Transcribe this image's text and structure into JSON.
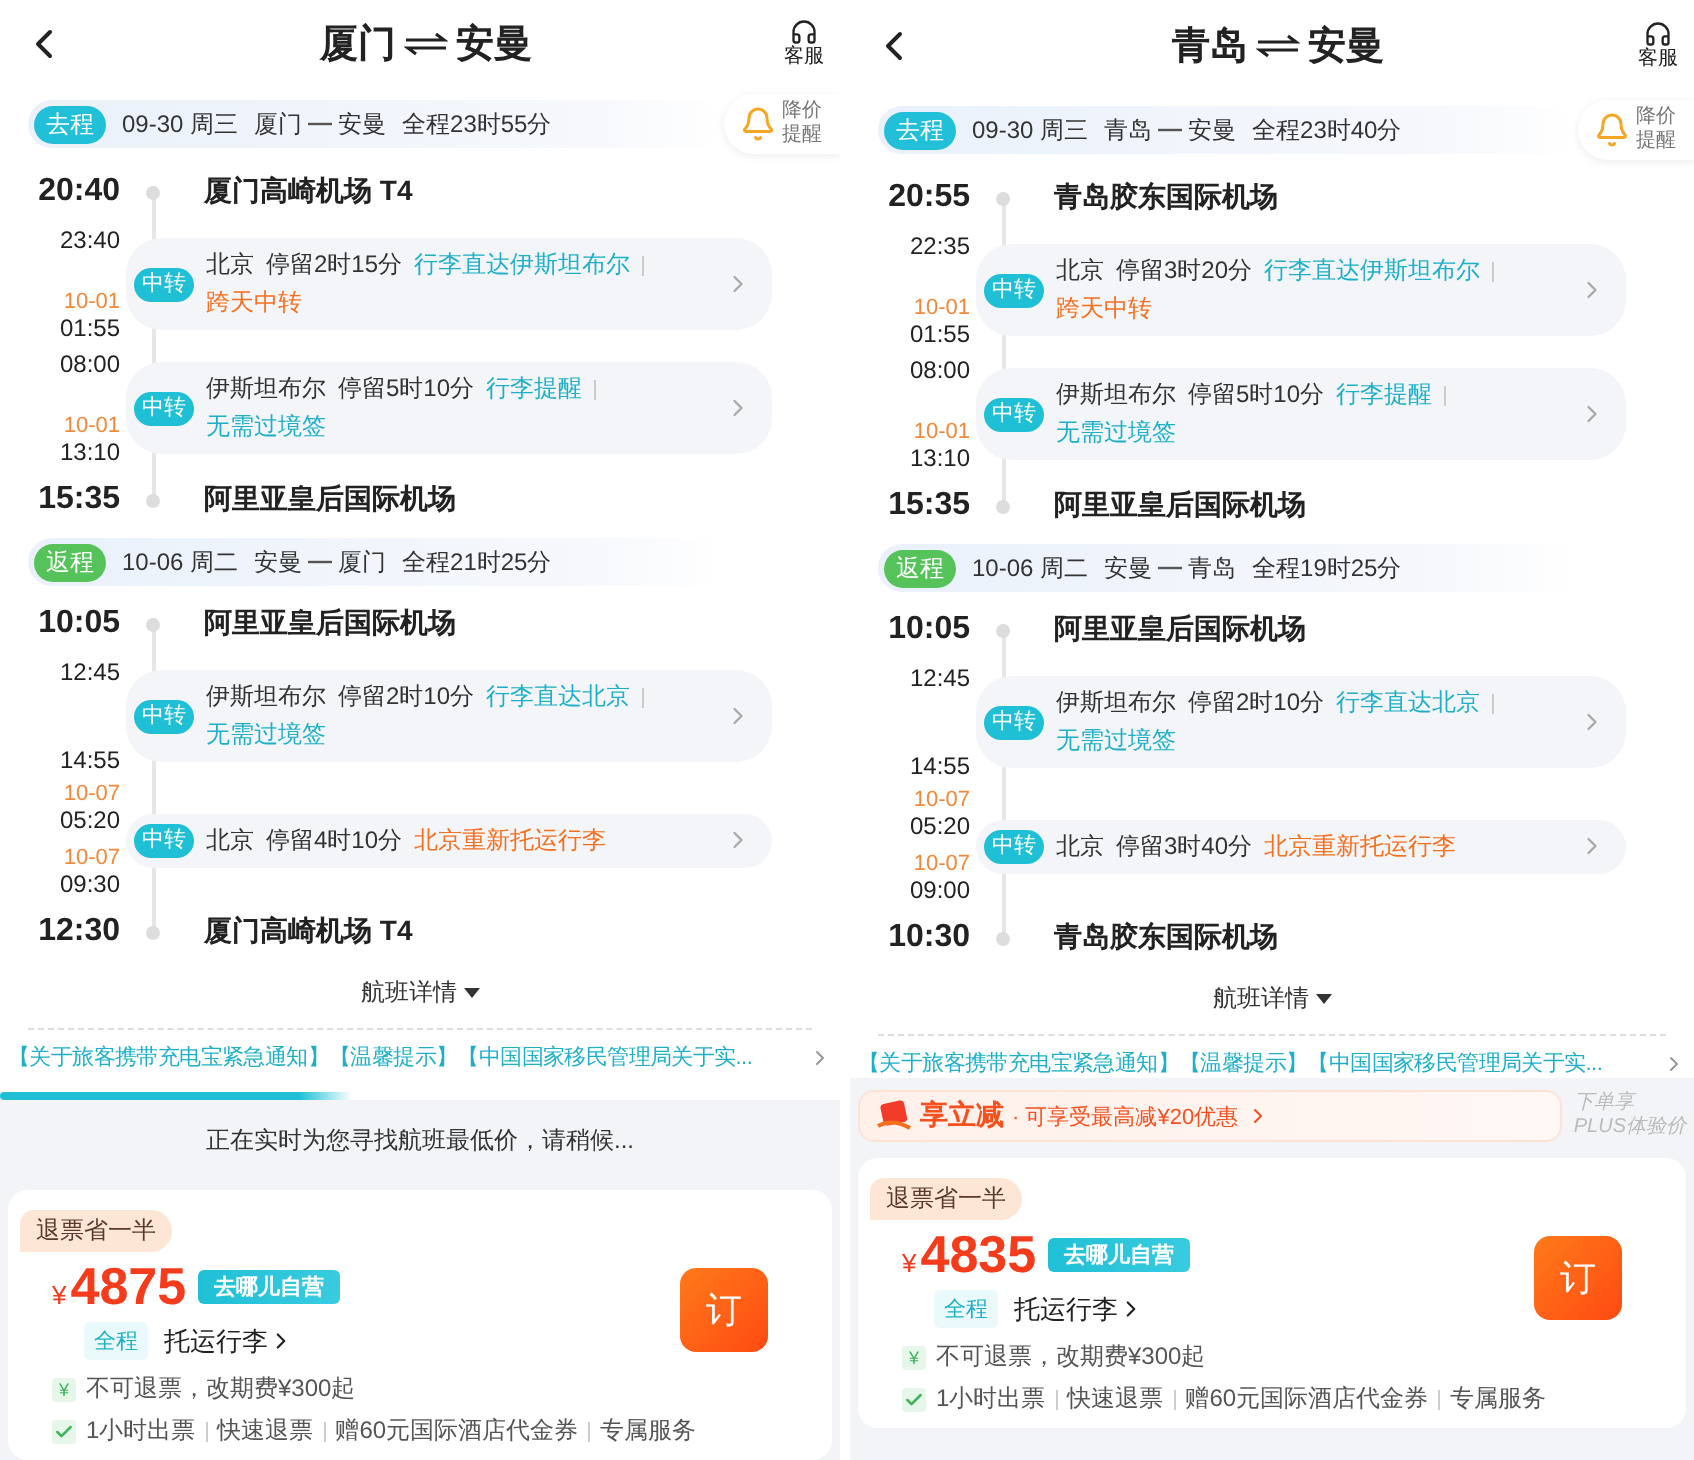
{
  "panels": [
    {
      "title": {
        "from": "厦门",
        "to": "安曼"
      },
      "support": "客服",
      "price_alert": [
        "降价",
        "提醒"
      ],
      "legs": [
        {
          "kind": "outbound",
          "tag": "去程",
          "date": "09-30 周三",
          "from": "厦门",
          "to": "安曼",
          "duration": "全程23时55分",
          "stops": [
            {
              "kind": "airport",
              "time": "20:40",
              "name": "厦门高崎机场 T4"
            },
            {
              "kind": "transfer",
              "arrive": {
                "time": "23:40"
              },
              "depart": {
                "date": "10-01",
                "time": "01:55"
              },
              "badge": "中转",
              "city": "北京",
              "stay": "停留2时15分",
              "notes": [
                {
                  "text": "行李直达伊斯坦布尔",
                  "color": "#1fb0c8"
                },
                {
                  "text": "跨天中转",
                  "color": "#f5701e"
                }
              ]
            },
            {
              "kind": "transfer",
              "arrive": {
                "time": "08:00"
              },
              "depart": {
                "date": "10-01",
                "time": "13:10"
              },
              "badge": "中转",
              "city": "伊斯坦布尔",
              "stay": "停留5时10分",
              "notes": [
                {
                  "text": "行李提醒",
                  "color": "#1fb0c8"
                },
                {
                  "text": "无需过境签",
                  "color": "#1fb0c8"
                }
              ]
            },
            {
              "kind": "airport",
              "time": "15:35",
              "name": "阿里亚皇后国际机场"
            }
          ]
        },
        {
          "kind": "return",
          "tag": "返程",
          "date": "10-06 周二",
          "from": "安曼",
          "to": "厦门",
          "duration": "全程21时25分",
          "stops": [
            {
              "kind": "airport",
              "time": "10:05",
              "name": "阿里亚皇后国际机场"
            },
            {
              "kind": "transfer",
              "arrive": {
                "time": "12:45"
              },
              "depart": {
                "time": "14:55"
              },
              "badge": "中转",
              "city": "伊斯坦布尔",
              "stay": "停留2时10分",
              "notes": [
                {
                  "text": "行李直达北京",
                  "color": "#1fb0c8"
                },
                {
                  "text": "无需过境签",
                  "color": "#1fb0c8"
                }
              ]
            },
            {
              "kind": "transfer",
              "arrive": {
                "date": "10-07",
                "time": "05:20"
              },
              "depart": {
                "date": "10-07",
                "time": "09:30"
              },
              "badge": "中转",
              "city": "北京",
              "stay": "停留4时10分",
              "notes": [
                {
                  "text": "北京重新托运行李",
                  "color": "#f5701e"
                }
              ]
            },
            {
              "kind": "airport",
              "time": "12:30",
              "name": "厦门高崎机场 T4"
            }
          ]
        }
      ],
      "details": "航班详情",
      "notice": "【关于旅客携带充电宝紧急通知】【温馨提示】【中国国家移民管理局关于实...",
      "progress": {
        "level": 0.42,
        "message": "正在实时为您寻找航班最低价，请稍候..."
      },
      "fare": {
        "tag": "退票省一半",
        "currency": "¥",
        "price": "4875",
        "seller": "去哪儿自营",
        "scope": "全程",
        "baggage": "托运行李",
        "book": "订",
        "features": [
          {
            "kind": "refund",
            "mark": "¥",
            "text": "不可退票，改期费¥300起"
          },
          {
            "kind": "service",
            "items": [
              "1小时出票",
              "快速退票",
              "赠60元国际酒店代金券",
              "专属服务"
            ]
          }
        ]
      }
    },
    {
      "title": {
        "from": "青岛",
        "to": "安曼"
      },
      "support": "客服",
      "price_alert": [
        "降价",
        "提醒"
      ],
      "legs": [
        {
          "kind": "outbound",
          "tag": "去程",
          "date": "09-30 周三",
          "from": "青岛",
          "to": "安曼",
          "duration": "全程23时40分",
          "stops": [
            {
              "kind": "airport",
              "time": "20:55",
              "name": "青岛胶东国际机场"
            },
            {
              "kind": "transfer",
              "arrive": {
                "time": "22:35"
              },
              "depart": {
                "date": "10-01",
                "time": "01:55"
              },
              "badge": "中转",
              "city": "北京",
              "stay": "停留3时20分",
              "notes": [
                {
                  "text": "行李直达伊斯坦布尔",
                  "color": "#1fb0c8"
                },
                {
                  "text": "跨天中转",
                  "color": "#f5701e"
                }
              ]
            },
            {
              "kind": "transfer",
              "arrive": {
                "time": "08:00"
              },
              "depart": {
                "date": "10-01",
                "time": "13:10"
              },
              "badge": "中转",
              "city": "伊斯坦布尔",
              "stay": "停留5时10分",
              "notes": [
                {
                  "text": "行李提醒",
                  "color": "#1fb0c8"
                },
                {
                  "text": "无需过境签",
                  "color": "#1fb0c8"
                }
              ]
            },
            {
              "kind": "airport",
              "time": "15:35",
              "name": "阿里亚皇后国际机场"
            }
          ]
        },
        {
          "kind": "return",
          "tag": "返程",
          "date": "10-06 周二",
          "from": "安曼",
          "to": "青岛",
          "duration": "全程19时25分",
          "stops": [
            {
              "kind": "airport",
              "time": "10:05",
              "name": "阿里亚皇后国际机场"
            },
            {
              "kind": "transfer",
              "arrive": {
                "time": "12:45"
              },
              "depart": {
                "time": "14:55"
              },
              "badge": "中转",
              "city": "伊斯坦布尔",
              "stay": "停留2时10分",
              "notes": [
                {
                  "text": "行李直达北京",
                  "color": "#1fb0c8"
                },
                {
                  "text": "无需过境签",
                  "color": "#1fb0c8"
                }
              ]
            },
            {
              "kind": "transfer",
              "arrive": {
                "date": "10-07",
                "time": "05:20"
              },
              "depart": {
                "date": "10-07",
                "time": "09:00"
              },
              "badge": "中转",
              "city": "北京",
              "stay": "停留3时40分",
              "notes": [
                {
                  "text": "北京重新托运行李",
                  "color": "#f5701e"
                }
              ]
            },
            {
              "kind": "airport",
              "time": "10:30",
              "name": "青岛胶东国际机场"
            }
          ]
        }
      ],
      "details": "航班详情",
      "notice": "【关于旅客携带充电宝紧急通知】【温馨提示】【中国国家移民管理局关于实...",
      "promo": {
        "title": "享立减",
        "text": "· 可享受最高减¥20优惠",
        "plus": [
          "下单享",
          "PLUS体验价"
        ]
      },
      "fare": {
        "tag": "退票省一半",
        "currency": "¥",
        "price": "4835",
        "seller": "去哪儿自营",
        "scope": "全程",
        "baggage": "托运行李",
        "book": "订",
        "features": [
          {
            "kind": "refund",
            "mark": "¥",
            "text": "不可退票，改期费¥300起"
          },
          {
            "kind": "service",
            "items": [
              "1小时出票",
              "快速退票",
              "赠60元国际酒店代金券",
              "专属服务"
            ]
          }
        ]
      }
    }
  ]
}
